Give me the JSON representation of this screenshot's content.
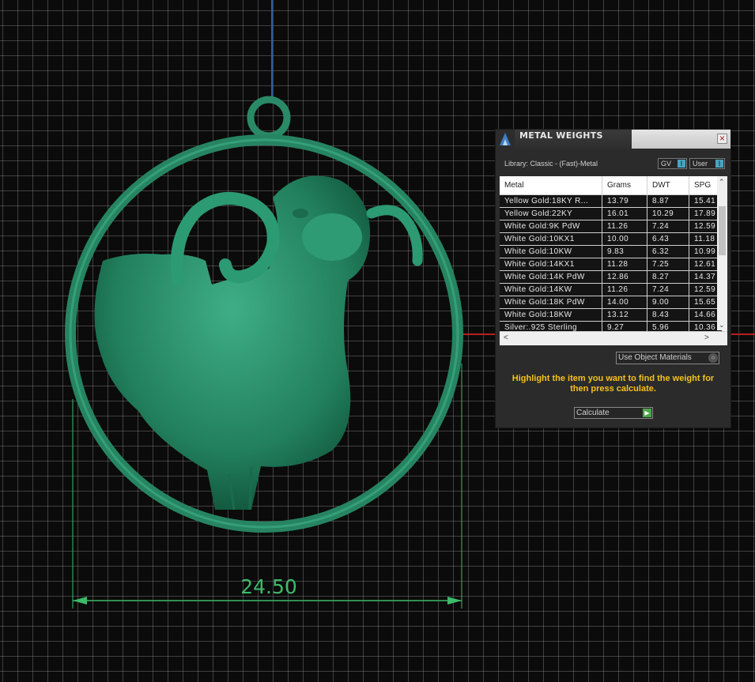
{
  "viewport": {
    "dimension_label": "24.50",
    "model_color": "#2a8a68",
    "dimension_color": "#3dba6a"
  },
  "panel": {
    "title": "METAL WEIGHTS",
    "close_glyph": "×",
    "library_label": "Library: Classic - (Fast)-Metal",
    "toggle_gv": "GV",
    "toggle_user": "User",
    "columns": [
      "Metal",
      "Grams",
      "DWT",
      "SPG"
    ],
    "rows": [
      {
        "metal": "Yellow Gold:18KY R...",
        "grams": "13.79",
        "dwt": "8.87",
        "spg": "15.41"
      },
      {
        "metal": "Yellow Gold:22KY",
        "grams": "16.01",
        "dwt": "10.29",
        "spg": "17.89"
      },
      {
        "metal": "White Gold:9K PdW",
        "grams": "11.26",
        "dwt": "7.24",
        "spg": "12.59"
      },
      {
        "metal": "White Gold:10KX1",
        "grams": "10.00",
        "dwt": "6.43",
        "spg": "11.18"
      },
      {
        "metal": "White Gold:10KW",
        "grams": "9.83",
        "dwt": "6.32",
        "spg": "10.99"
      },
      {
        "metal": "White Gold:14KX1",
        "grams": "11.28",
        "dwt": "7.25",
        "spg": "12.61"
      },
      {
        "metal": "White Gold:14K PdW",
        "grams": "12.86",
        "dwt": "8.27",
        "spg": "14.37"
      },
      {
        "metal": "White Gold:14KW",
        "grams": "11.26",
        "dwt": "7.24",
        "spg": "12.59"
      },
      {
        "metal": "White Gold:18K PdW",
        "grams": "14.00",
        "dwt": "9.00",
        "spg": "15.65"
      },
      {
        "metal": "White Gold:18KW",
        "grams": "13.12",
        "dwt": "8.43",
        "spg": "14.66"
      },
      {
        "metal": "Silver:.925 Sterling",
        "grams": "9.27",
        "dwt": "5.96",
        "spg": "10.36"
      }
    ],
    "material_dropdown": "Use Object Materials",
    "instruction": "Highlight the item you want to find the weight for then press calculate.",
    "calculate_label": "Calculate"
  }
}
